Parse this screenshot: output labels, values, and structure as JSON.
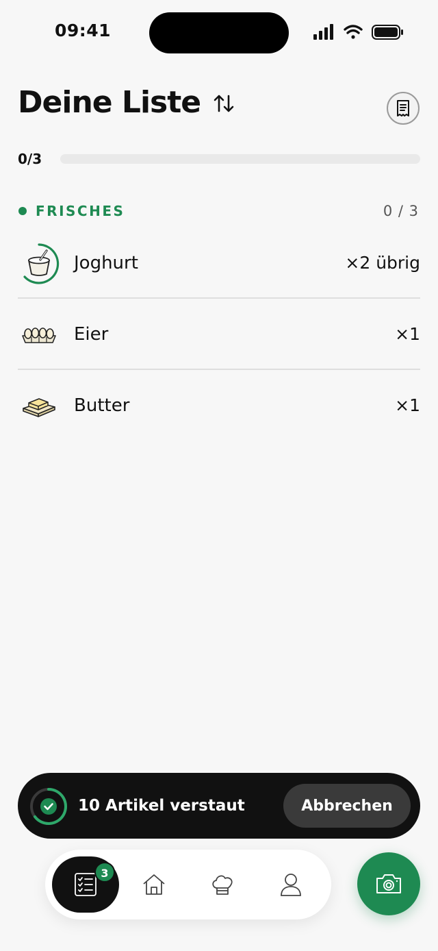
{
  "status_bar": {
    "time": "09:41"
  },
  "header": {
    "title": "Deine Liste"
  },
  "progress": {
    "label": "0/3",
    "fraction": 0
  },
  "section": {
    "title": "FRISCHES",
    "count": "0 / 3"
  },
  "items": [
    {
      "name": "Joghurt",
      "qty": "×2 übrig",
      "icon": "yogurt-icon"
    },
    {
      "name": "Eier",
      "qty": "×1",
      "icon": "egg-carton-icon"
    },
    {
      "name": "Butter",
      "qty": "×1",
      "icon": "butter-icon"
    }
  ],
  "toast": {
    "message": "10 Artikel verstaut",
    "cancel_label": "Abbrechen"
  },
  "tab_bar": {
    "badge": "3",
    "tabs": [
      "list-icon",
      "home-icon",
      "chef-hat-icon",
      "profile-icon"
    ]
  },
  "colors": {
    "accent": "#1e8a52",
    "toast_bg": "#111111",
    "ring": "#2ea86a",
    "background": "#f7f7f7"
  }
}
